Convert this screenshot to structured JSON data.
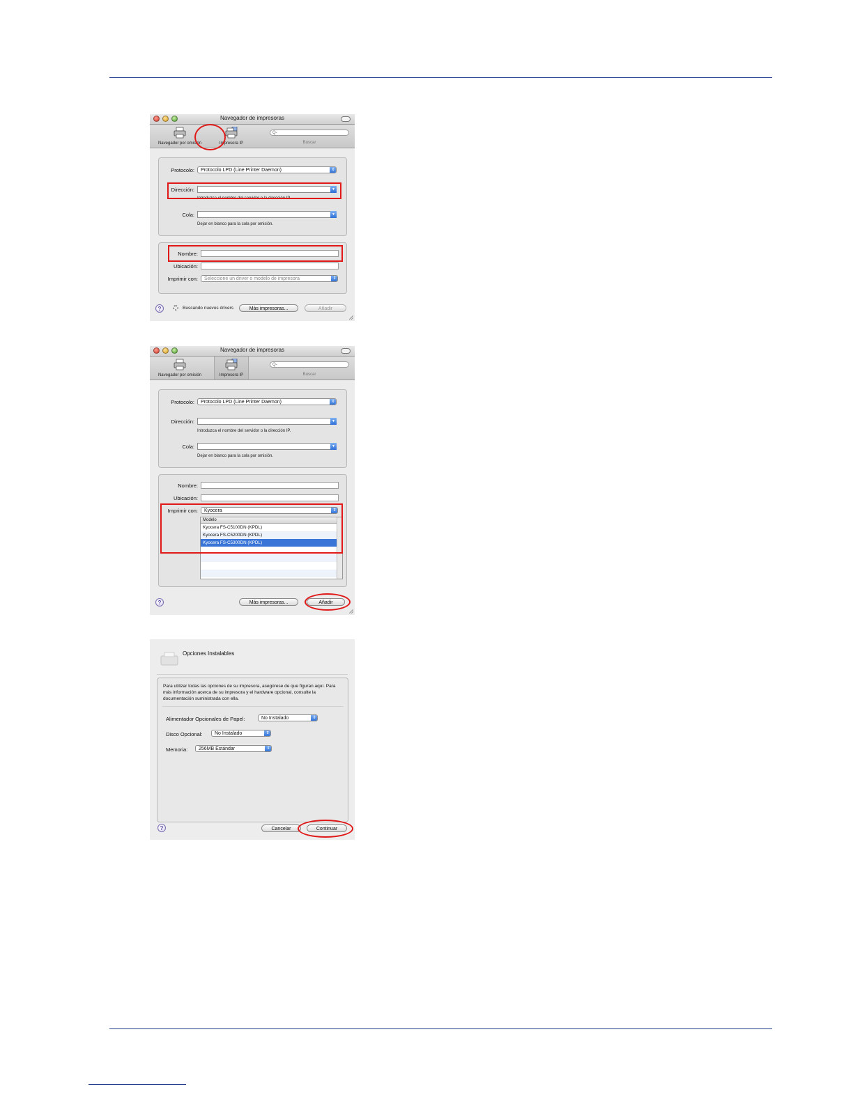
{
  "window_title": "Navegador de impresoras",
  "toolbar": {
    "default_label": "Navegador por omisión",
    "ip_label": "Impresora IP",
    "search_placeholder": "Q-",
    "search_label": "Buscar"
  },
  "form": {
    "protocol_label": "Protocolo:",
    "protocol_value": "Protocolo LPD (Line Printer Daemon)",
    "address_label": "Dirección:",
    "address_hint": "Introduzca el nombre del servidor o la dirección IP.",
    "queue_label": "Cola:",
    "queue_hint": "Dejar en blanco para la cola por omisión.",
    "name_label": "Nombre:",
    "location_label": "Ubicación:",
    "print_with_label": "Imprimir con:",
    "print_with_placeholder": "Seleccione un driver o modelo de impresora",
    "print_with_value": "Kyocera"
  },
  "footer": {
    "searching_text": "Buscando nuevos drivers",
    "more_printers": "Más impresoras...",
    "add": "Añadir"
  },
  "model_list": {
    "header": "Modelo",
    "items": [
      "Kyocera FS-C5100DN (KPDL)",
      "Kyocera FS-C5200DN (KPDL)",
      "Kyocera FS-C5300DN (KPDL)"
    ],
    "selected_index": 2
  },
  "options_dialog": {
    "title": "Opciones Instalables",
    "description": "Para utilizar todas las opciones de su impresora, asegúrese de que figuran aquí. Para más información acerca de su impresora y el hardware opcional, consulte la documentación suministrada con ella.",
    "feeder_label": "Alimentador Opcionales de Papel:",
    "feeder_value": "No Instalado",
    "disk_label": "Disco Opcional:",
    "disk_value": "No Instalado",
    "memory_label": "Memoria:",
    "memory_value": "256MB Estándar",
    "cancel": "Cancelar",
    "continue": "Continuar"
  },
  "colors": {
    "rule": "#1f3c8c",
    "highlight": "#e01818",
    "selection": "#3875d7"
  }
}
